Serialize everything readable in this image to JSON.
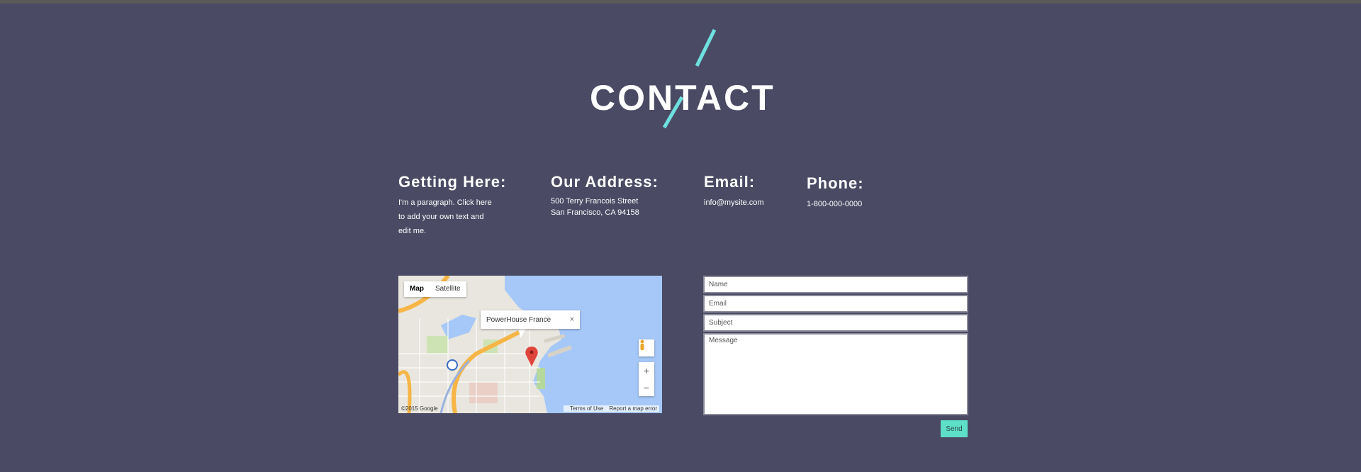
{
  "header": {
    "title": "CONTACT",
    "accent_color": "#6ee0e0"
  },
  "info": {
    "getting_here": {
      "heading": "Getting Here:",
      "lines": [
        "I'm a paragraph. Click here",
        "to add your own text and",
        "edit me."
      ]
    },
    "address": {
      "heading": "Our Address:",
      "lines": [
        "500 Terry Francois Street",
        "San Francisco, CA 94158"
      ]
    },
    "email": {
      "heading": "Email:",
      "value": "info@mysite.com"
    },
    "phone": {
      "heading": "Phone:",
      "value": "1-800-000-0000"
    }
  },
  "map": {
    "tabs": [
      "Map",
      "Satellite"
    ],
    "active_tab": "Map",
    "infowindow": "PowerHouse France",
    "close_glyph": "×",
    "zoom_in": "+",
    "zoom_out": "−",
    "attribution": "©2015 Google",
    "links": [
      "Terms of Use",
      "Report a map error"
    ],
    "icons": [
      "pegman-icon",
      "map-marker-icon",
      "close-icon"
    ]
  },
  "form": {
    "name_placeholder": "Name",
    "email_placeholder": "Email",
    "subject_placeholder": "Subject",
    "message_placeholder": "Message",
    "send_label": "Send"
  },
  "colors": {
    "background": "#4a4a64",
    "accent": "#6ee0e0",
    "button": "#5ee0c8",
    "water": "#a6c8f8"
  }
}
